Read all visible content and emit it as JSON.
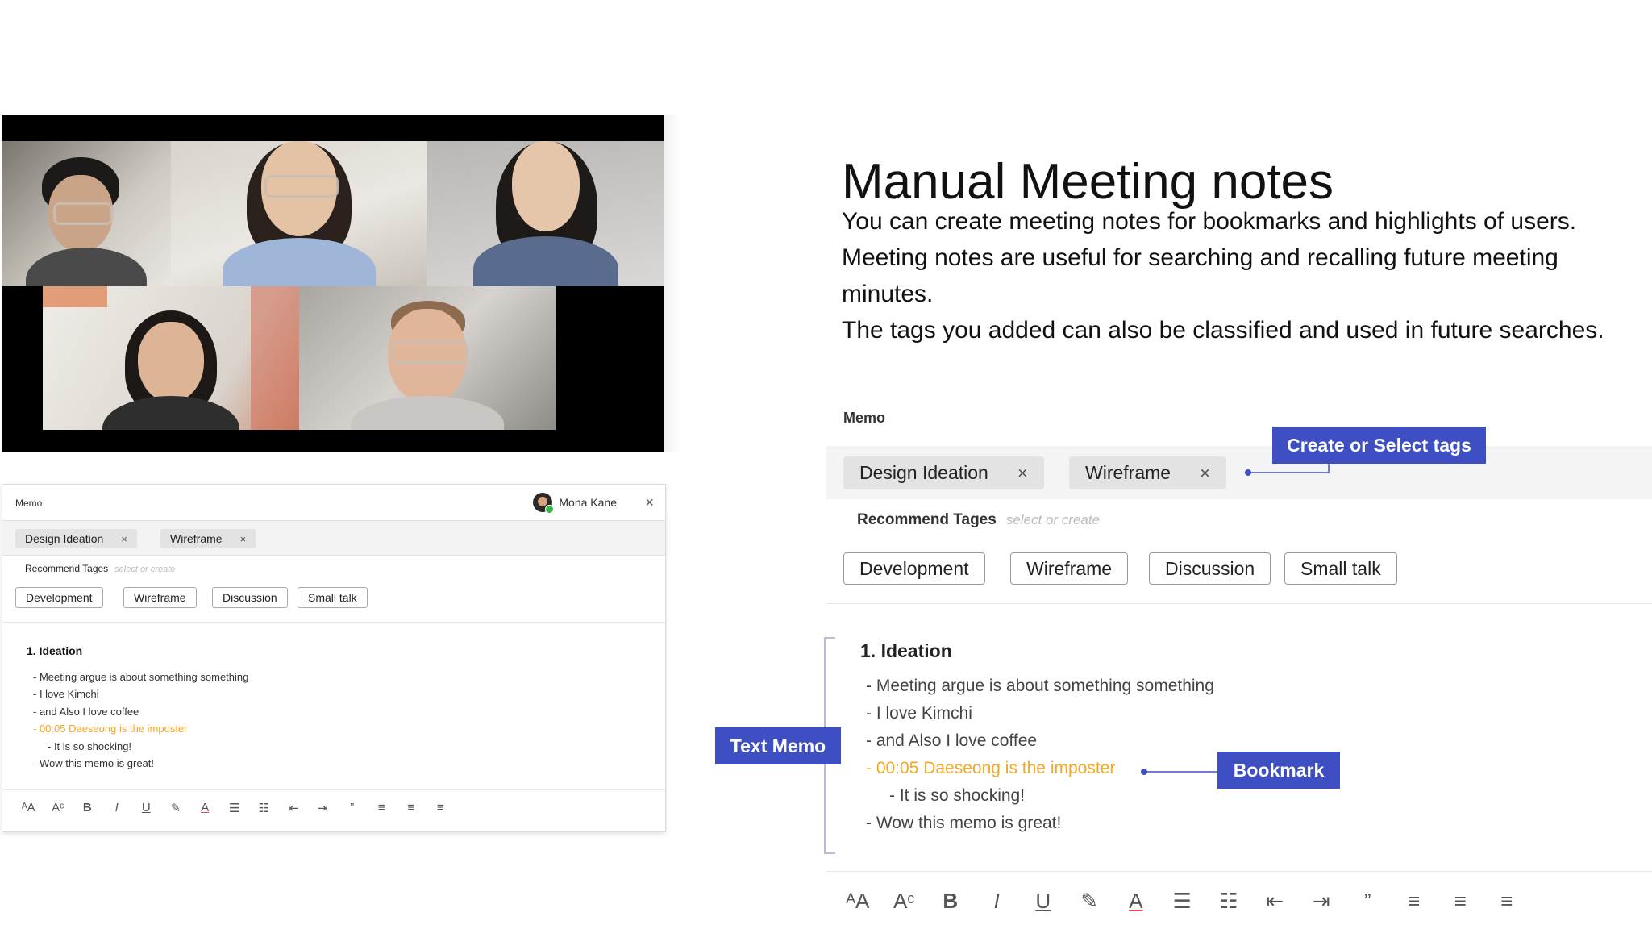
{
  "heading": "Manual Meeting notes",
  "description": [
    "You can create meeting notes for bookmarks and highlights of users.",
    "Meeting notes are useful for searching and recalling future meeting minutes.",
    "The tags you added can also be classified and used in future searches."
  ],
  "small_panel": {
    "title": "Memo",
    "user_name": "Mona Kane",
    "close_icon": "×",
    "tags": [
      {
        "label": "Design Ideation",
        "remove": "×"
      },
      {
        "label": "Wireframe",
        "remove": "×"
      }
    ],
    "recommend_label": "Recommend Tages",
    "recommend_placeholder": "select or create",
    "recommend_buttons": [
      "Development",
      "Wireframe",
      "Discussion",
      "Small talk"
    ],
    "notes": {
      "heading": "1. Ideation",
      "lines": [
        "- Meeting argue is about something something",
        "- I love Kimchi",
        "- and Also I love coffee",
        "- 00:05 Daeseong is the imposter",
        "- It is so shocking!",
        "- Wow this memo is great!"
      ]
    }
  },
  "big_panel": {
    "title": "Memo",
    "tags": [
      {
        "label": "Design Ideation",
        "remove": "×"
      },
      {
        "label": "Wireframe",
        "remove": "×"
      }
    ],
    "recommend_label": "Recommend Tages",
    "recommend_placeholder": "select or create",
    "recommend_buttons": [
      "Development",
      "Wireframe",
      "Discussion",
      "Small talk"
    ],
    "notes": {
      "heading": "1. Ideation",
      "lines": [
        "- Meeting argue is about something something",
        "- I love Kimchi",
        "- and Also I love coffee",
        "- 00:05 Daeseong is the imposter",
        "- It is so shocking!",
        "- Wow this memo is great!"
      ]
    }
  },
  "callouts": {
    "tags": "Create or Select tags",
    "text_memo": "Text Memo",
    "bookmark": "Bookmark"
  },
  "toolbar_glyphs": {
    "font_size": "ᴬA",
    "font_super": "Aᶜ",
    "bold": "B",
    "italic": "I",
    "underline": "U",
    "highlight": "✎",
    "font_color": "A",
    "bulleted_list": "☰",
    "numbered_list": "☷",
    "outdent": "⇤",
    "indent": "⇥",
    "quote": "”",
    "align_left": "≡",
    "align_center": "≡",
    "align_right": "≡"
  },
  "colors": {
    "accent": "#3d4fc2",
    "bookmark_text": "#f5a623"
  }
}
